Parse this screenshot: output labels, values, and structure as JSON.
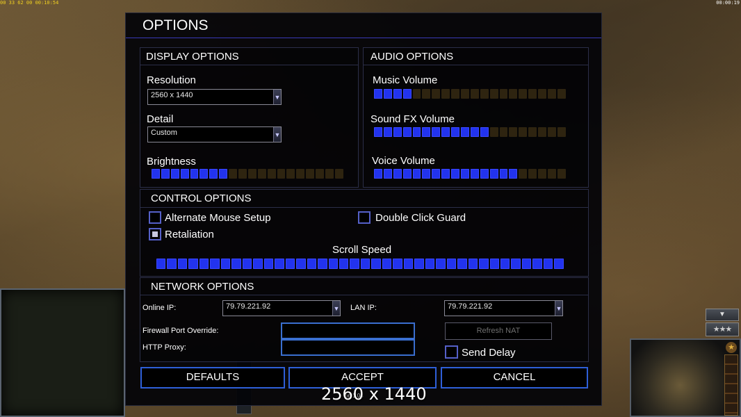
{
  "hud": {
    "fps_text": "00 33 62 00 00:10:54",
    "clock_text": "00:00:19",
    "side_arrow": "▼",
    "side_rank": "★★★",
    "cmd_star": "★"
  },
  "dialog": {
    "title": "OPTIONS",
    "display": {
      "heading": "DISPLAY OPTIONS",
      "resolution_label": "Resolution",
      "resolution_value": "2560 x 1440",
      "detail_label": "Detail",
      "detail_value": "Custom",
      "brightness_label": "Brightness",
      "brightness_level": 0.4
    },
    "audio": {
      "heading": "AUDIO OPTIONS",
      "music_label": "Music Volume",
      "music_level": 0.2,
      "sfx_label": "Sound FX Volume",
      "sfx_level": 0.6,
      "voice_label": "Voice Volume",
      "voice_level": 0.75
    },
    "control": {
      "heading": "CONTROL OPTIONS",
      "alt_mouse_label": "Alternate Mouse Setup",
      "alt_mouse_checked": false,
      "double_click_label": "Double Click Guard",
      "double_click_checked": false,
      "retaliation_label": "Retaliation",
      "retaliation_checked": true,
      "scroll_label": "Scroll Speed",
      "scroll_level": 1.0
    },
    "network": {
      "heading": "NETWORK OPTIONS",
      "online_ip_label": "Online IP:",
      "online_ip_value": "79.79.221.92",
      "lan_ip_label": "LAN IP:",
      "lan_ip_value": "79.79.221.92",
      "firewall_label": "Firewall Port Override:",
      "firewall_value": "",
      "http_proxy_label": "HTTP Proxy:",
      "http_proxy_value": "",
      "refresh_nat_label": "Refresh NAT",
      "send_delay_label": "Send Delay",
      "send_delay_checked": false
    },
    "buttons": {
      "defaults": "DEFAULTS",
      "accept": "ACCEPT",
      "cancel": "CANCEL"
    },
    "version_text": "on 1.04",
    "tooltip_text": "2560 x 1440"
  }
}
